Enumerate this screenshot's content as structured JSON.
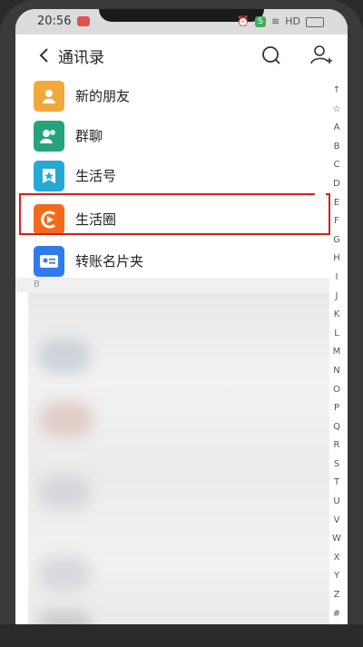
{
  "status_bar": {
    "time": "20:56",
    "network": "HD"
  },
  "header": {
    "title": "通讯录"
  },
  "list_items": [
    {
      "label": "新的朋友",
      "color": "#f2a93b",
      "icon": "person-icon"
    },
    {
      "label": "群聊",
      "color": "#26a37a",
      "icon": "group-icon"
    },
    {
      "label": "生活号",
      "color": "#27a9d6",
      "icon": "star-badge-icon"
    },
    {
      "label": "生活圈",
      "color": "#f26b1d",
      "icon": "circle-icon"
    },
    {
      "label": "转账名片夹",
      "color": "#2f7be9",
      "icon": "card-icon"
    }
  ],
  "section_header": "B",
  "index_letters": [
    "↑",
    "☆",
    "A",
    "B",
    "C",
    "D",
    "E",
    "F",
    "G",
    "H",
    "I",
    "J",
    "K",
    "L",
    "M",
    "N",
    "O",
    "P",
    "Q",
    "R",
    "S",
    "T",
    "U",
    "V",
    "W",
    "X",
    "Y",
    "Z",
    "#"
  ]
}
